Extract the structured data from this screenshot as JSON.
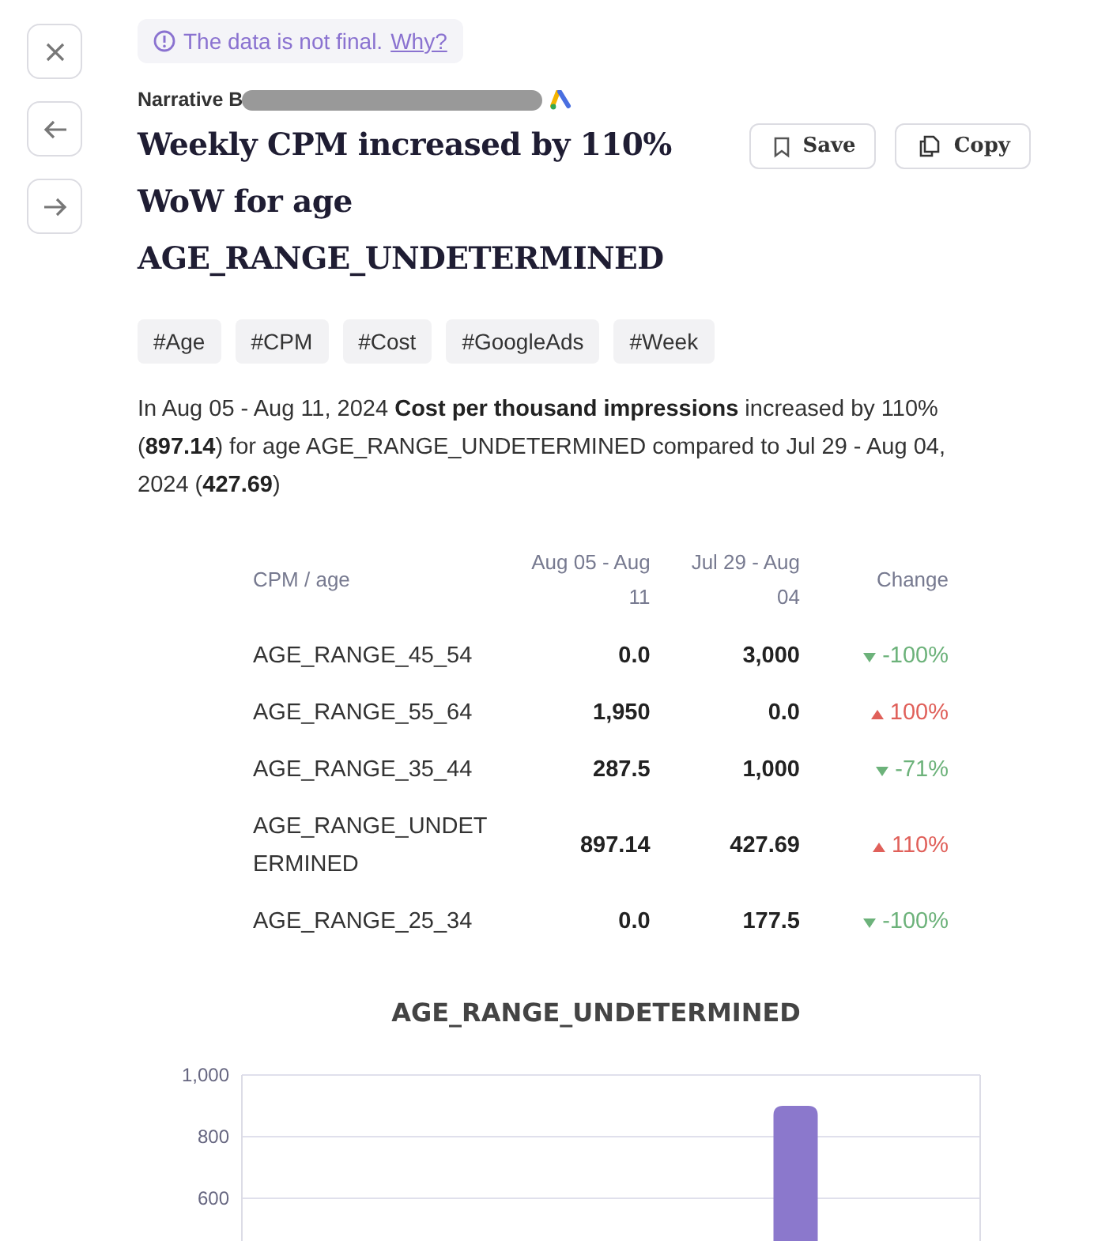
{
  "notice": {
    "text": "The data is not final.",
    "link": "Why?"
  },
  "source": {
    "name": "Narrative B",
    "redacted": true
  },
  "title": "Weekly CPM increased by 110% WoW for age AGE_RANGE_UNDETERMINED",
  "actions": [
    {
      "label": "Save"
    },
    {
      "label": "Copy"
    }
  ],
  "tags": [
    "#Age",
    "#CPM",
    "#Cost",
    "#GoogleAds",
    "#Week"
  ],
  "summary": "In Aug 05 - Aug 11, 2024 **Cost per thousand impressions** increased by 110% (**897.14**) for age AGE_RANGE_UNDETERMINED compared to Jul 29 - Aug 04, 2024 (**427.69**)",
  "table": {
    "columns": [
      "CPM / age",
      "Aug 05 - Aug 11",
      "Jul 29 - Aug 04",
      "Change"
    ],
    "rows": [
      {
        "label": "AGE_RANGE_45_54",
        "current": "0.0",
        "previous": "3,000",
        "change": "-100%",
        "kind": "down"
      },
      {
        "label": "AGE_RANGE_55_64",
        "current": "1,950",
        "previous": "0.0",
        "change": "100%",
        "kind": "up"
      },
      {
        "label": "AGE_RANGE_35_44",
        "current": "287.5",
        "previous": "1,000",
        "change": "-71%",
        "kind": "down"
      },
      {
        "label": "AGE_RANGE_UNDETERMINED",
        "current": "897.14",
        "previous": "427.69",
        "change": "110%",
        "kind": "up"
      },
      {
        "label": "AGE_RANGE_25_34",
        "current": "0.0",
        "previous": "177.5",
        "change": "-100%",
        "kind": "down"
      }
    ]
  },
  "chart": {
    "chart_data": {
      "type": "bar",
      "title": "AGE_RANGE_UNDETERMINED",
      "ylim": [
        440,
        1000
      ],
      "yticks": [
        {
          "value": 600,
          "label": "600"
        },
        {
          "value": 800,
          "label": "800"
        },
        {
          "value": 1000,
          "label": "1,000"
        }
      ],
      "series": [
        {
          "color": "#8b78cc",
          "values": [
            null,
            900
          ]
        }
      ]
    }
  }
}
